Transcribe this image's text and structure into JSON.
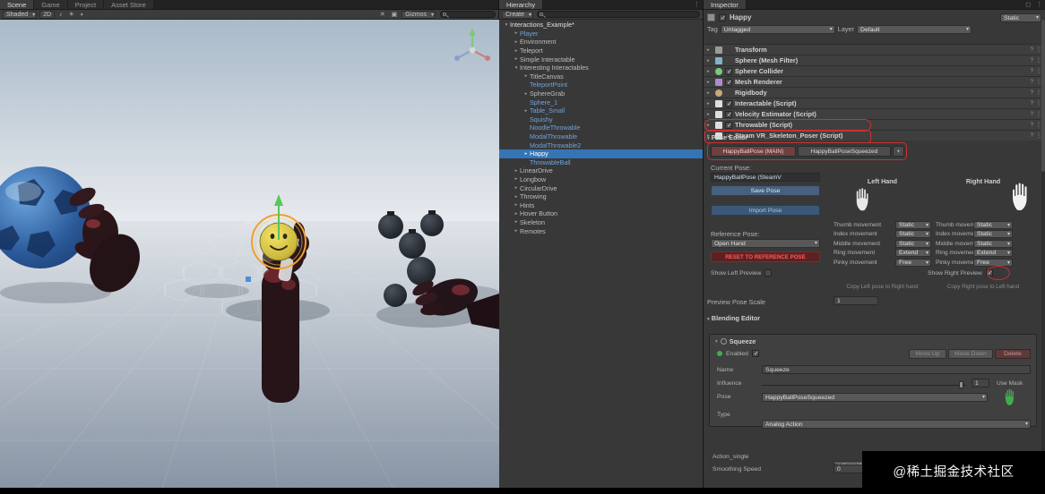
{
  "colors": {
    "accent_blue": "#3575b5",
    "prefab_blue": "#6fa3dc",
    "annotation_red": "#cf2f2f",
    "reset_red": "#ff5c5c",
    "mask_green": "#3fae4a"
  },
  "scene_panel": {
    "tabs": [
      {
        "label": "Scene",
        "active": true
      },
      {
        "label": "Game",
        "active": false
      },
      {
        "label": "Project",
        "active": false
      },
      {
        "label": "Asset Store",
        "active": false
      }
    ],
    "toolbar": {
      "shading": "Shaded",
      "mode_2d": "2D",
      "gizmos": "Gizmos",
      "audio_icon": "♪",
      "lighting_icon": "☀",
      "effects_icon": "◐",
      "tool1_icon": "✕",
      "tool2_icon": "▣"
    }
  },
  "hierarchy": {
    "tab": "Hierarchy",
    "create_button": "Create",
    "items": [
      {
        "label": "Interactions_Example*",
        "depth": 0,
        "arrow": "▾",
        "root": true
      },
      {
        "label": "Player",
        "depth": 1,
        "arrow": "▸",
        "prefab": true
      },
      {
        "label": "Environment",
        "depth": 1,
        "arrow": "▸"
      },
      {
        "label": "Teleport",
        "depth": 1,
        "arrow": "▸"
      },
      {
        "label": "Simple Interactable",
        "depth": 1,
        "arrow": "▸"
      },
      {
        "label": "Interesting Interactables",
        "depth": 1,
        "arrow": "▾"
      },
      {
        "label": "TitleCanvas",
        "depth": 2,
        "arrow": "▸"
      },
      {
        "label": "TeleportPoint",
        "depth": 2,
        "arrow": "",
        "prefab": true
      },
      {
        "label": "SphereGrab",
        "depth": 2,
        "arrow": "▸"
      },
      {
        "label": "Sphere_1",
        "depth": 2,
        "arrow": "",
        "prefab": true
      },
      {
        "label": "Table_Small",
        "depth": 2,
        "arrow": "▸",
        "prefab": true
      },
      {
        "label": "Squishy",
        "depth": 2,
        "arrow": "",
        "prefab": true
      },
      {
        "label": "NoodleThrowable",
        "depth": 2,
        "arrow": "",
        "prefab": true
      },
      {
        "label": "ModalThrowable",
        "depth": 2,
        "arrow": "",
        "prefab": true
      },
      {
        "label": "ModalThrowable2",
        "depth": 2,
        "arrow": "",
        "prefab": true
      },
      {
        "label": "Happy",
        "depth": 2,
        "arrow": "▸",
        "selected": true
      },
      {
        "label": "ThrowableBall",
        "depth": 2,
        "arrow": "",
        "prefab": true
      },
      {
        "label": "LinearDrive",
        "depth": 1,
        "arrow": "▸"
      },
      {
        "label": "Longbow",
        "depth": 1,
        "arrow": "▸"
      },
      {
        "label": "CircularDrive",
        "depth": 1,
        "arrow": "▸"
      },
      {
        "label": "Throwing",
        "depth": 1,
        "arrow": "▸"
      },
      {
        "label": "Hints",
        "depth": 1,
        "arrow": "▸"
      },
      {
        "label": "Hover Button",
        "depth": 1,
        "arrow": "▸"
      },
      {
        "label": "Skeleton",
        "depth": 1,
        "arrow": "▸"
      },
      {
        "label": "Remotes",
        "depth": 1,
        "arrow": "▸"
      }
    ]
  },
  "inspector": {
    "tab": "Inspector",
    "header": {
      "name": "Happy",
      "static_label": "Static"
    },
    "tag_row": {
      "tag_label": "Tag",
      "tag_value": "Untagged",
      "layer_label": "Layer",
      "layer_value": "Default"
    },
    "components": [
      {
        "name": "Transform",
        "icon": "transform",
        "checkbox": false,
        "checked": false,
        "highlight": false
      },
      {
        "name": "Sphere (Mesh Filter)",
        "icon": "mesh",
        "checkbox": false,
        "checked": false,
        "highlight": false
      },
      {
        "name": "Sphere Collider",
        "icon": "collider",
        "checkbox": true,
        "checked": true,
        "highlight": false
      },
      {
        "name": "Mesh Renderer",
        "icon": "renderer",
        "checkbox": true,
        "checked": true,
        "highlight": false
      },
      {
        "name": "Rigidbody",
        "icon": "rigidbody",
        "checkbox": false,
        "checked": false,
        "highlight": false
      },
      {
        "name": "Interactable (Script)",
        "icon": "script",
        "checkbox": true,
        "checked": true,
        "highlight": false
      },
      {
        "name": "Velocity Estimator (Script)",
        "icon": "script",
        "checkbox": true,
        "checked": true,
        "highlight": false
      },
      {
        "name": "Throwable (Script)",
        "icon": "script",
        "checkbox": true,
        "checked": true,
        "highlight": false
      },
      {
        "name": "Steam VR_Skeleton_Poser (Script)",
        "icon": "script",
        "checkbox": true,
        "checked": true,
        "highlight": true
      }
    ],
    "pose_editor": {
      "title": "Pose Editor",
      "pose_tabs": [
        {
          "label": "HappyBallPose (MAIN)"
        },
        {
          "label": "HappyBallPoseSqueezed"
        }
      ],
      "add_tab": "+",
      "current_pose_label": "Current Pose:",
      "current_pose_value": "HappyBallPose (SteamV",
      "save_pose": "Save Pose",
      "import_pose": "Import Pose",
      "reference_pose_label": "Reference Pose:",
      "reference_pose_value": "Open Hand",
      "reset_button": "RESET TO REFERENCE POSE",
      "left_hand": "Left Hand",
      "right_hand": "Right Hand",
      "fingers": [
        {
          "name": "Thumb movement",
          "left": "Static",
          "right": "Static"
        },
        {
          "name": "Index movement",
          "left": "Static",
          "right": "Static"
        },
        {
          "name": "Middle movement",
          "left": "Static",
          "right": "Static"
        },
        {
          "name": "Ring movement",
          "left": "Extend",
          "right": "Extend"
        },
        {
          "name": "Pinky movement",
          "left": "Free",
          "right": "Free"
        }
      ],
      "show_left_preview": "Show Left Preview",
      "show_right_preview": "Show Right Preview",
      "copy_left": "Copy Left pose to Right hand",
      "copy_right": "Copy Right pose to Left hand",
      "preview_scale_label": "Preview Pose Scale",
      "preview_scale_value": "1"
    },
    "blending_editor": {
      "title": "Blending Editor",
      "behaviour_name": "Squeeze",
      "enabled_label": "Enabled",
      "move_up": "Move Up",
      "move_down": "Move Down",
      "delete": "Delete",
      "name_label": "Name",
      "name_value": "Squeeze",
      "influence_label": "Influence",
      "influence_value": "1",
      "use_mask_label": "Use Mask",
      "pose_label": "Pose",
      "pose_value": "HappyBallPoseSqueezed",
      "type_label": "Type",
      "type_value": "Analog Action",
      "action_label": "Action_single",
      "action_value": "actions/default/In/Squeeze",
      "smoothing_label": "Smoothing Speed",
      "smoothing_value": "0"
    }
  },
  "watermark": "@稀土掘金技术社区"
}
